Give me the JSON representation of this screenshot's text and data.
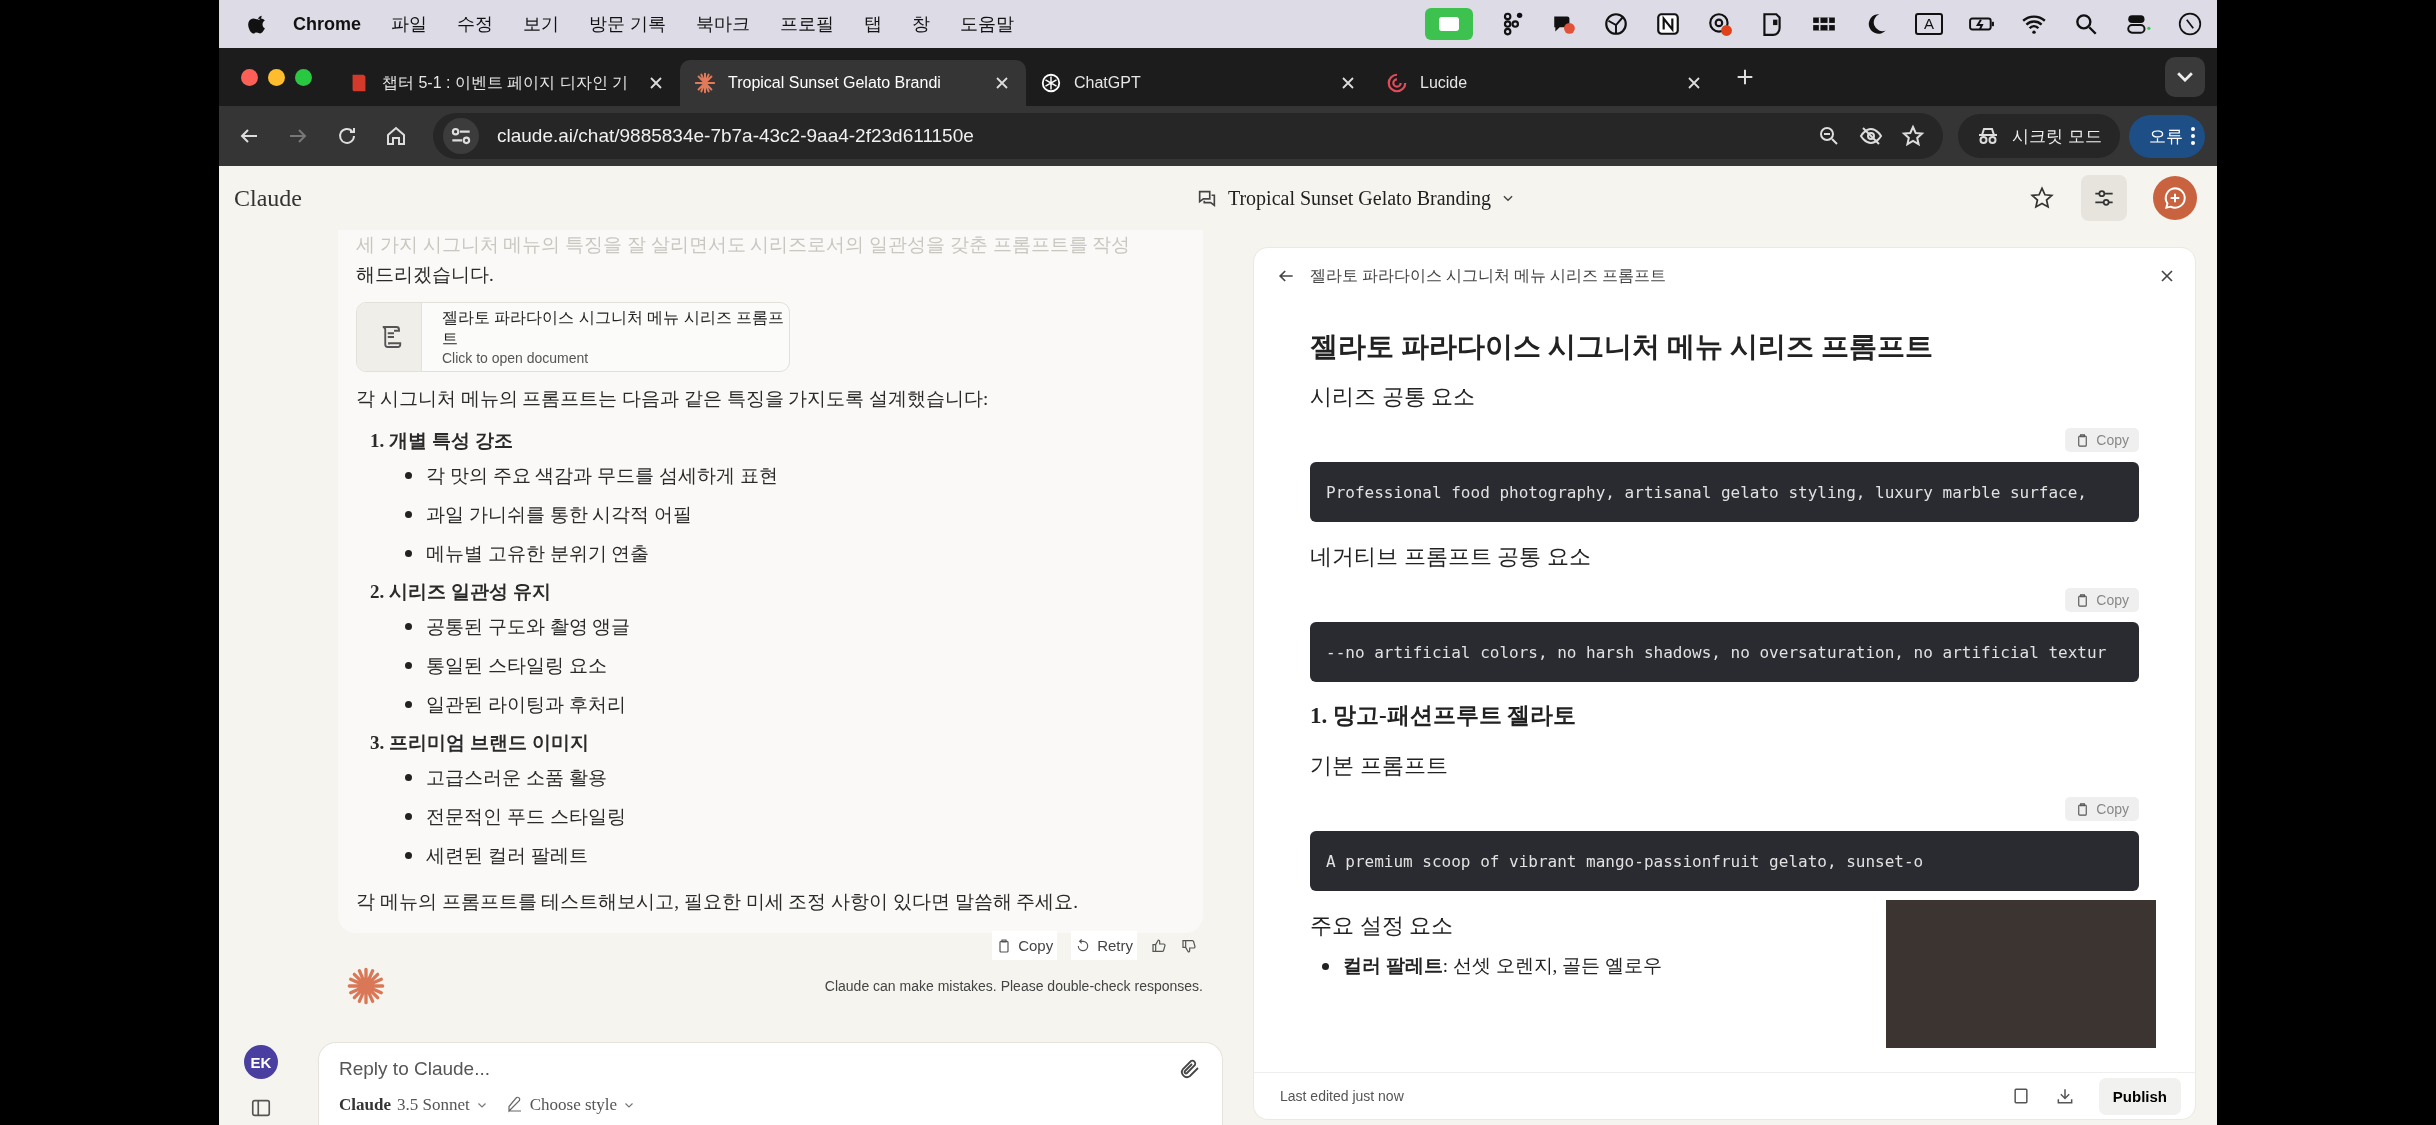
{
  "menubar": {
    "app": "Chrome",
    "menus": [
      "파일",
      "수정",
      "보기",
      "방문 기록",
      "북마크",
      "프로필",
      "탭",
      "창",
      "도움말"
    ],
    "input_source": "A"
  },
  "tabs": [
    {
      "title": "챕터 5-1 : 이벤트 페이지 디자인 기",
      "selected": false
    },
    {
      "title": "Tropical Sunset Gelato Brandi",
      "selected": true
    },
    {
      "title": "ChatGPT",
      "selected": false
    },
    {
      "title": "Lucide",
      "selected": false
    }
  ],
  "address_bar": {
    "url": "claude.ai/chat/9885834e-7b7a-43c2-9aa4-2f23d611150e"
  },
  "incognito": {
    "label": "시크릿 모드"
  },
  "error_button": {
    "label": "오류"
  },
  "header": {
    "logo": "Claude",
    "title": "Tropical Sunset Gelato Branding"
  },
  "chat": {
    "intro_lines": [
      "세 가지 시그니처 메뉴의 특징을 잘 살리면서도 시리즈로서의 일관성을 갖춘 프롬프트를 작성",
      "해드리겠습니다."
    ],
    "document_card": {
      "title": "젤라토 파라다이스 시그니처 메뉴 시리즈 프롬프트",
      "subtitle": "Click to open document"
    },
    "lead": "각 시그니처 메뉴의 프롬프트는 다음과 같은 특징을 가지도록 설계했습니다:",
    "sections": [
      {
        "title": "1. 개별 특성 강조",
        "bullets": [
          "각 맛의 주요 색감과 무드를 섬세하게 표현",
          "과일 가니쉬를 통한 시각적 어필",
          "메뉴별 고유한 분위기 연출"
        ]
      },
      {
        "title": "2. 시리즈 일관성 유지",
        "bullets": [
          "공통된 구도와 촬영 앵글",
          "통일된 스타일링 요소",
          "일관된 라이팅과 후처리"
        ]
      },
      {
        "title": "3. 프리미엄 브랜드 이미지",
        "bullets": [
          "고급스러운 소품 활용",
          "전문적인 푸드 스타일링",
          "세련된 컬러 팔레트"
        ]
      }
    ],
    "closing": "각 메뉴의 프롬프트를 테스트해보시고, 필요한 미세 조정 사항이 있다면 말씀해 주세요.",
    "actions": [
      "Copy",
      "Retry"
    ],
    "disclaimer": "Claude can make mistakes. Please double-check responses."
  },
  "sidebar": {
    "avatar": "EK"
  },
  "composer": {
    "placeholder": "Reply to Claude...",
    "model_name": "Claude",
    "model_version": "3.5 Sonnet",
    "style": "Choose style"
  },
  "artifact": {
    "header_title": "젤라토 파라다이스 시그니처 메뉴 시리즈 프롬프트",
    "blocks": [
      {
        "kind": "h1",
        "text": "젤라토 파라다이스 시그니처 메뉴 시리즈 프롬프트"
      },
      {
        "kind": "h2",
        "text": "시리즈 공통 요소"
      },
      {
        "kind": "code",
        "copy": "Copy",
        "text": "Professional food photography, artisanal gelato styling, luxury marble surface,"
      },
      {
        "kind": "h2",
        "text": "네거티브 프롬프트 공통 요소"
      },
      {
        "kind": "code",
        "copy": "Copy",
        "text": "--no artificial colors, no harsh shadows, no oversaturation, no artificial textur"
      },
      {
        "kind": "h3",
        "text": "1. 망고-패션프루트 젤라토"
      },
      {
        "kind": "h2",
        "text": "기본 프롬프트"
      },
      {
        "kind": "code",
        "copy": "Copy",
        "text": "A premium scoop of vibrant mango-passionfruit gelato, sunset-o"
      },
      {
        "kind": "h2",
        "text": "주요 설정 요소"
      },
      {
        "kind": "bullet",
        "text": "**컬러 팔레트**: 선셋 오렌지, 골든 옐로우"
      }
    ],
    "footer": {
      "status": "Last edited just now",
      "publish": "Publish"
    }
  }
}
